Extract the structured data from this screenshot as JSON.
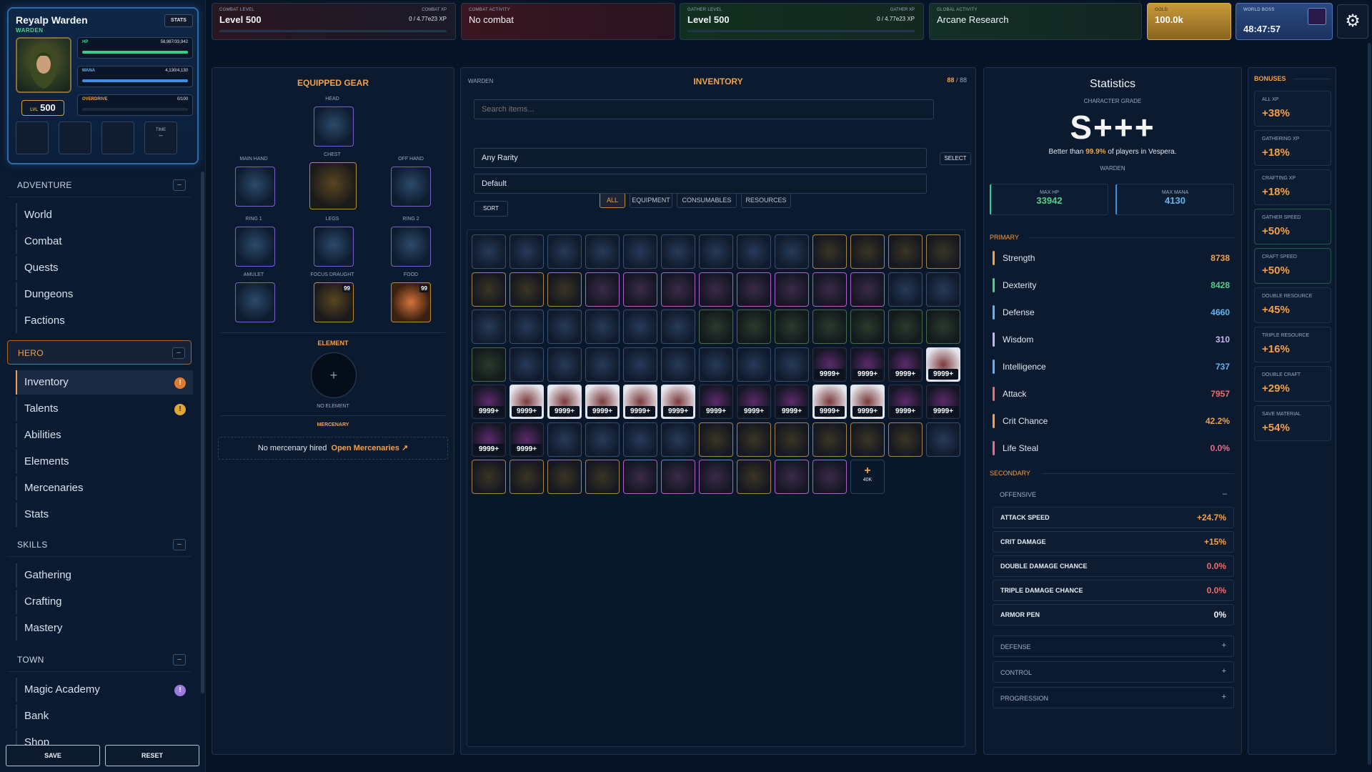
{
  "hero": {
    "name": "Reyalp Warden",
    "class": "WARDEN",
    "stats_btn": "STATS",
    "hp_label": "HP",
    "hp_value": "58,987/33,942",
    "mana_label": "MANA",
    "mana_value": "4,130/4,130",
    "overdrive_label": "OVERDRIVE",
    "overdrive_value": "0/100",
    "level_prefix": "LVL",
    "level": "500",
    "time_label": "TIME",
    "time_value": "--"
  },
  "nav": {
    "adventure": {
      "title": "ADVENTURE",
      "toggle": "–",
      "items": [
        "World",
        "Combat",
        "Quests",
        "Dungeons",
        "Factions"
      ]
    },
    "hero": {
      "title": "HERO",
      "toggle": "–",
      "items": [
        "Inventory",
        "Talents",
        "Abilities",
        "Elements",
        "Mercenaries",
        "Stats"
      ],
      "badges": [
        "!",
        "!"
      ]
    },
    "skills": {
      "title": "SKILLS",
      "toggle": "–",
      "items": [
        "Gathering",
        "Crafting",
        "Mastery"
      ]
    },
    "town": {
      "title": "TOWN",
      "toggle": "–",
      "items": [
        "Magic Academy",
        "Bank",
        "Shop"
      ],
      "badges": [
        "!"
      ]
    },
    "save": "SAVE",
    "reset": "RESET"
  },
  "topbar": {
    "combat": {
      "label": "COMBAT LEVEL",
      "value": "Level 500",
      "xp_label": "COMBAT XP",
      "xp_value": "0 / 4.77e23 XP"
    },
    "combat_activity": {
      "label": "COMBAT ACTIVITY",
      "value": "No combat"
    },
    "gather": {
      "label": "GATHER LEVEL",
      "value": "Level 500",
      "xp_label": "GATHER XP",
      "xp_value": "0 / 4.77e23 XP"
    },
    "global": {
      "label": "GLOBAL ACTIVITY",
      "value": "Arcane Research"
    },
    "gold": {
      "label": "GOLD",
      "value": "100.0k"
    },
    "boss": {
      "label": "WORLD BOSS",
      "value": "48:47:57"
    }
  },
  "gear": {
    "title": "EQUIPPED GEAR",
    "slots": {
      "head": "HEAD",
      "main": "MAIN HAND",
      "chest": "CHEST",
      "off": "OFF HAND",
      "ring1": "RING 1",
      "legs": "LEGS",
      "ring2": "RING 2",
      "amulet": "AMULET",
      "focus": "FOCUS DRAUGHT",
      "food": "FOOD"
    },
    "focus_count": "99",
    "food_count": "99",
    "element_title": "ELEMENT",
    "element_plus": "+",
    "element_none": "NO ELEMENT",
    "merc_title": "MERCENARY",
    "merc_text": "No mercenary hired",
    "merc_link": "Open Mercenaries ↗"
  },
  "inventory": {
    "class_label": "WARDEN",
    "title": "INVENTORY",
    "count": "88",
    "capacity": "88",
    "count_sep": "/",
    "search_placeholder": "Search items...",
    "tabs": [
      "ALL",
      "EQUIPMENT",
      "CONSUMABLES",
      "RESOURCES"
    ],
    "rarity": "Any Rarity",
    "select_btn": "SELECT",
    "sort_mode": "Default",
    "sort_btn": "SORT",
    "qty": "9999+",
    "expand_plus": "+",
    "expand_label": "40K"
  },
  "statistics": {
    "title": "Statistics",
    "grade_label": "CHARACTER GRADE",
    "grade": "S+++",
    "better_prefix": "Better than",
    "better_pct": "99.9%",
    "better_suffix": "of players in Vespera.",
    "class": "WARDEN",
    "max_hp_label": "MAX HP",
    "max_hp": "33942",
    "max_mana_label": "MAX MANA",
    "max_mana": "4130",
    "primary_title": "PRIMARY",
    "primary": [
      {
        "name": "Strength",
        "value": "8738",
        "color": "#f2a14a"
      },
      {
        "name": "Dexterity",
        "value": "8428",
        "color": "#4fd18b"
      },
      {
        "name": "Defense",
        "value": "4660",
        "color": "#5fb4f0"
      },
      {
        "name": "Wisdom",
        "value": "310",
        "color": "#c9b4f0"
      },
      {
        "name": "Intelligence",
        "value": "737",
        "color": "#5fb4f0"
      },
      {
        "name": "Attack",
        "value": "7957",
        "color": "#f06a6a"
      },
      {
        "name": "Crit Chance",
        "value": "42.2%",
        "color": "#f2a14a"
      },
      {
        "name": "Life Steal",
        "value": "0.0%",
        "color": "#f06a8a"
      }
    ],
    "secondary_title": "SECONDARY",
    "offensive_title": "OFFENSIVE",
    "offensive_icon": "–",
    "offensive": [
      {
        "name": "ATTACK SPEED",
        "value": "+24.7%",
        "color": "#f2a14a"
      },
      {
        "name": "CRIT DAMAGE",
        "value": "+15%",
        "color": "#f2a14a"
      },
      {
        "name": "DOUBLE DAMAGE CHANCE",
        "value": "0.0%",
        "color": "#f06a6a"
      },
      {
        "name": "TRIPLE DAMAGE CHANCE",
        "value": "0.0%",
        "color": "#f06a6a"
      },
      {
        "name": "ARMOR PEN",
        "value": "0%",
        "color": "#f2f5fa"
      }
    ],
    "collapsed": [
      {
        "name": "DEFENSE",
        "icon": "+"
      },
      {
        "name": "CONTROL",
        "icon": "+"
      },
      {
        "name": "PROGRESSION",
        "icon": "+"
      }
    ]
  },
  "bonuses": {
    "title": "BONUSES",
    "items": [
      {
        "label": "ALL XP",
        "value": "+38%"
      },
      {
        "label": "GATHERING XP",
        "value": "+18%"
      },
      {
        "label": "CRAFTING XP",
        "value": "+18%"
      },
      {
        "label": "GATHER SPEED",
        "value": "+50%"
      },
      {
        "label": "CRAFT SPEED",
        "value": "+50%"
      },
      {
        "label": "DOUBLE RESOURCE",
        "value": "+45%"
      },
      {
        "label": "TRIPLE RESOURCE",
        "value": "+16%"
      },
      {
        "label": "DOUBLE CRAFT",
        "value": "+29%"
      },
      {
        "label": "SAVE MATERIAL",
        "value": "+54%"
      }
    ]
  }
}
